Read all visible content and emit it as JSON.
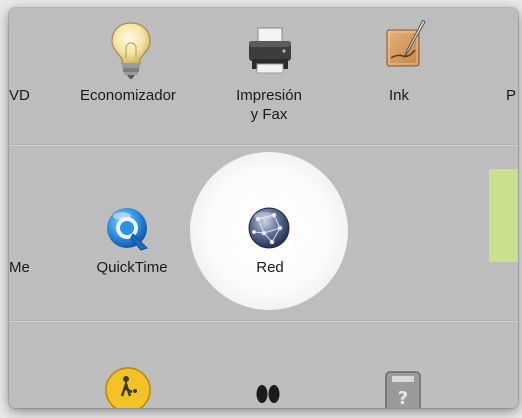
{
  "row1": {
    "partial_left": "VD",
    "items": [
      {
        "label": "Economizador",
        "icon": "lightbulb-icon"
      },
      {
        "label_line1": "Impresión",
        "label_line2": "y Fax",
        "icon": "printer-icon"
      },
      {
        "label": "Ink",
        "icon": "ink-pen-icon"
      }
    ],
    "partial_right": "P"
  },
  "row2": {
    "partial_left": "Me",
    "items": [
      {
        "label": "QuickTime",
        "icon": "quicktime-icon"
      },
      {
        "label": "Red",
        "icon": "network-globe-icon",
        "highlighted": true
      }
    ]
  },
  "row3": {
    "items": [
      {
        "icon": "parental-controls-icon"
      },
      {
        "icon": "footprints-icon"
      },
      {
        "icon": "disk-question-icon"
      }
    ]
  },
  "colors": {
    "pane_bg": "#bdbdbd",
    "highlight": "#ffffff",
    "green_accent": "#c9e08d"
  }
}
